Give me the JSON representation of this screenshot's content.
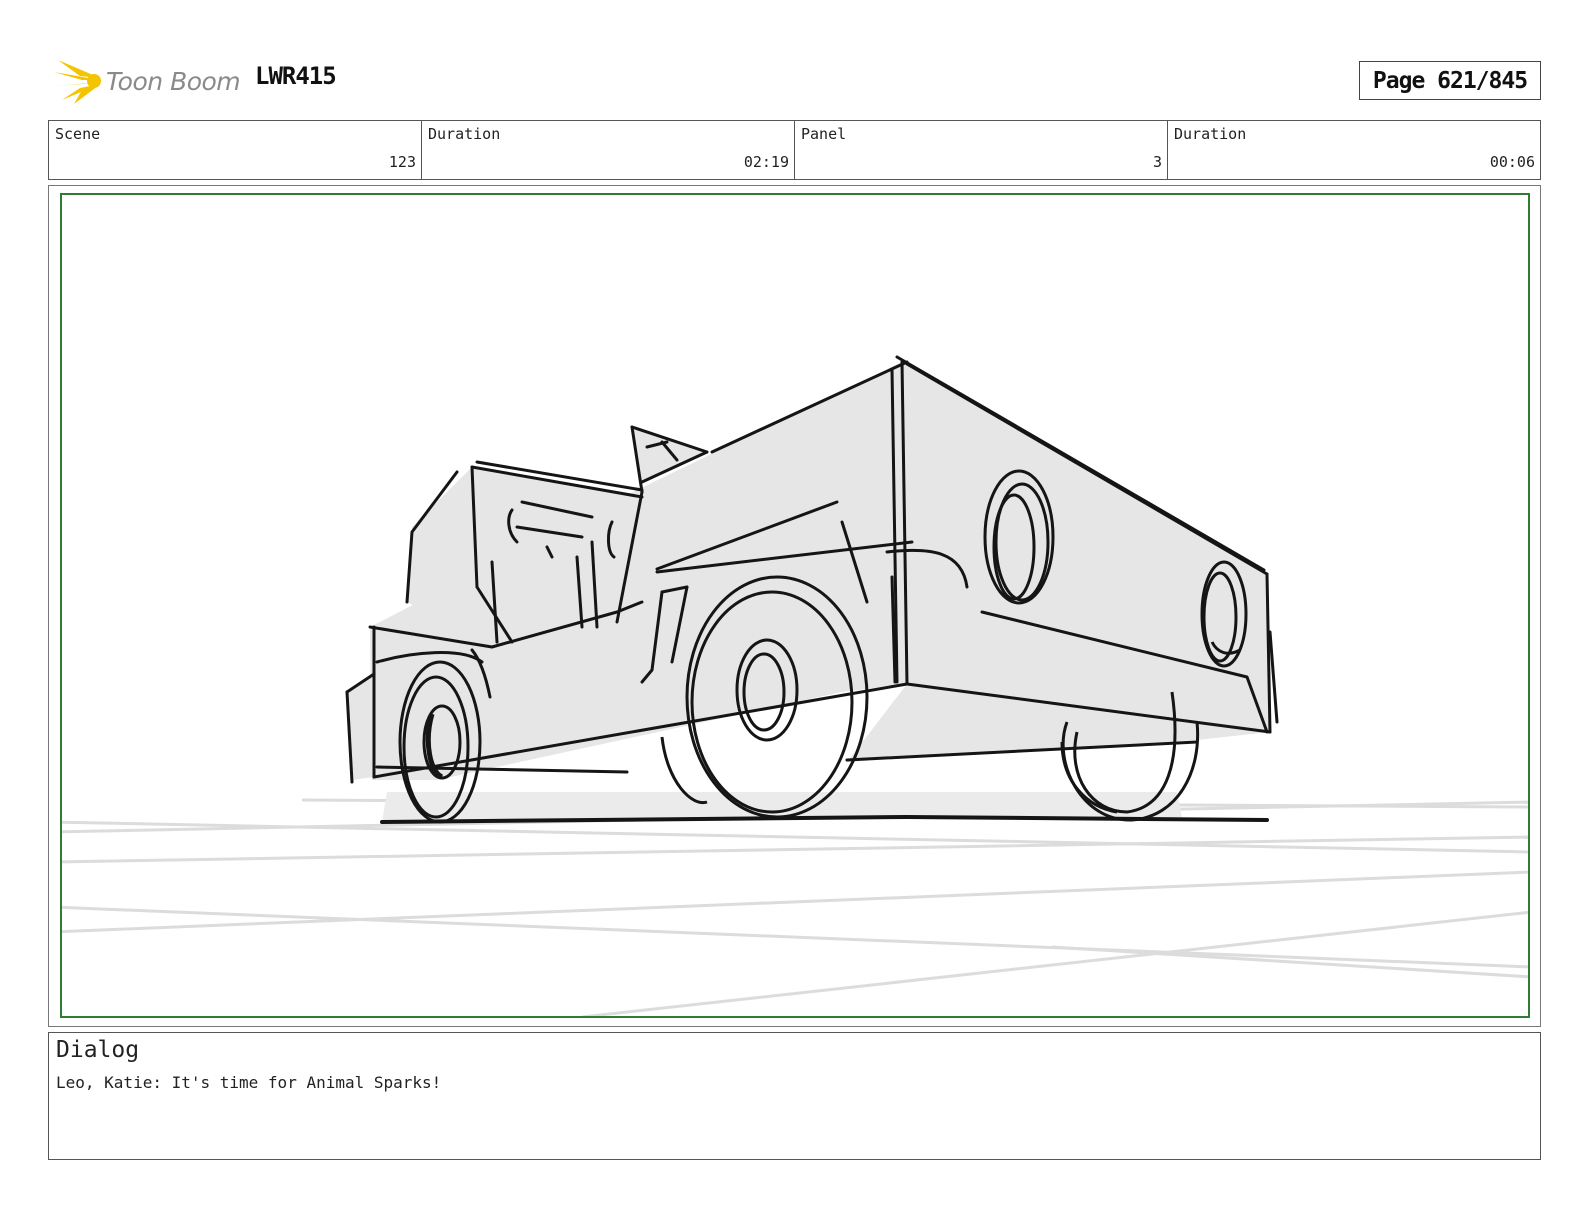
{
  "header": {
    "logo_text": "Toon Boom",
    "logo_icon": "starburst-icon",
    "project_code": "LWR415",
    "page_label": "Page 621/845"
  },
  "info": [
    {
      "label": "Scene",
      "value": "123"
    },
    {
      "label": "Duration",
      "value": "02:19"
    },
    {
      "label": "Panel",
      "value": "3"
    },
    {
      "label": "Duration",
      "value": "00:06"
    }
  ],
  "panel": {
    "frame_color": "#2e7d32"
  },
  "dialog": {
    "title": "Dialog",
    "text": "Leo, Katie: It's time for Animal Sparks!"
  },
  "colors": {
    "logo_accent": "#f5c400",
    "sketch_fill": "#e6e6e6",
    "sketch_line": "#151515"
  }
}
